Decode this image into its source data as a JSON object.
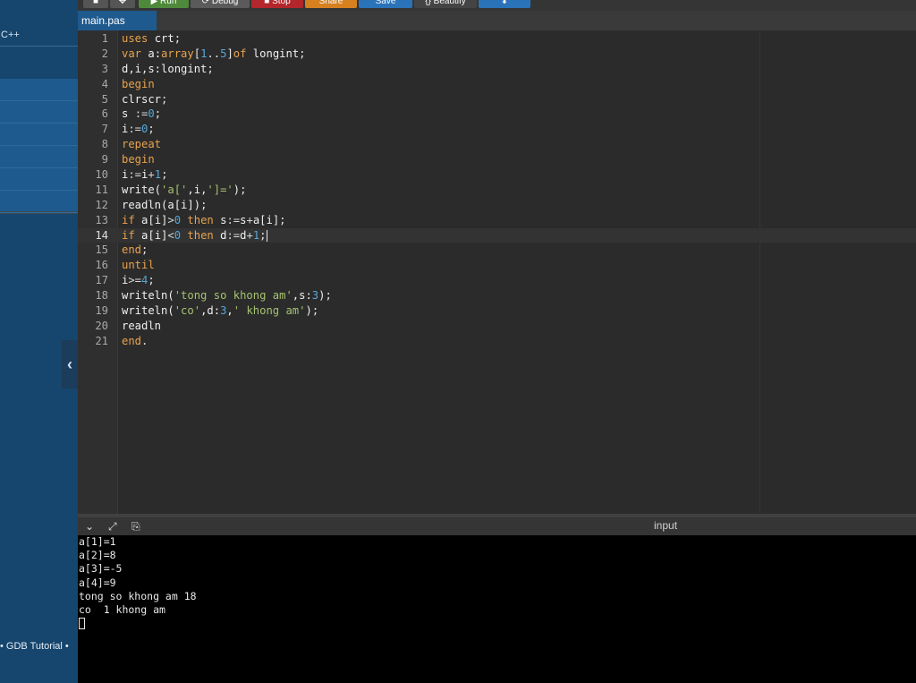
{
  "sidebar": {
    "language_label": "C++",
    "collapse_icon": "chevron-left-icon",
    "footer_link": "• GDB Tutorial •"
  },
  "toolbar": {
    "buttons": [
      {
        "label": "■",
        "color": "#555555"
      },
      {
        "label": "✥",
        "color": "#555555"
      },
      {
        "label": "▶ Run",
        "color": "#4f8a3c"
      },
      {
        "label": "⟳ Debug",
        "color": "#5a5a5a"
      },
      {
        "label": "■ Stop",
        "color": "#b3262c"
      },
      {
        "label": "Share",
        "color": "#d7801f"
      },
      {
        "label": "Save",
        "color": "#2a73b8"
      },
      {
        "label": "{} Beautify",
        "color": "#444444"
      },
      {
        "label": "⬇",
        "color": "#2a73b8"
      }
    ]
  },
  "tab": {
    "filename": "main.pas"
  },
  "editor": {
    "active_line": 14,
    "lines": [
      [
        [
          "kw",
          "uses"
        ],
        [
          "var",
          " crt"
        ],
        [
          "punct",
          ";"
        ]
      ],
      [
        [
          "kw",
          "var"
        ],
        [
          "var",
          " a:"
        ],
        [
          "kw",
          "array"
        ],
        [
          "punct",
          "["
        ],
        [
          "num",
          "1"
        ],
        [
          "punct",
          ".."
        ],
        [
          "num",
          "5"
        ],
        [
          "punct",
          "]"
        ],
        [
          "kw",
          "of"
        ],
        [
          "var",
          " longint"
        ],
        [
          "punct",
          ";"
        ]
      ],
      [
        [
          "var",
          "d,i,s:longint"
        ],
        [
          "punct",
          ";"
        ]
      ],
      [
        [
          "kw",
          "begin"
        ]
      ],
      [
        [
          "var",
          "clrscr"
        ],
        [
          "punct",
          ";"
        ]
      ],
      [
        [
          "var",
          "s "
        ],
        [
          "op",
          ":="
        ],
        [
          "num",
          "0"
        ],
        [
          "punct",
          ";"
        ]
      ],
      [
        [
          "var",
          "i"
        ],
        [
          "op",
          ":="
        ],
        [
          "num",
          "0"
        ],
        [
          "punct",
          ";"
        ]
      ],
      [
        [
          "kw",
          "repeat"
        ]
      ],
      [
        [
          "kw",
          "begin"
        ]
      ],
      [
        [
          "var",
          "i"
        ],
        [
          "op",
          ":="
        ],
        [
          "var",
          "i"
        ],
        [
          "op",
          "+"
        ],
        [
          "num",
          "1"
        ],
        [
          "punct",
          ";"
        ]
      ],
      [
        [
          "var",
          "write("
        ],
        [
          "str",
          "'a['"
        ],
        [
          "var",
          ",i,"
        ],
        [
          "str",
          "']='"
        ],
        [
          "var",
          ")"
        ],
        [
          "punct",
          ";"
        ]
      ],
      [
        [
          "var",
          "readln(a[i])"
        ],
        [
          "punct",
          ";"
        ]
      ],
      [
        [
          "kw",
          "if"
        ],
        [
          "var",
          " a[i]"
        ],
        [
          "op",
          ">"
        ],
        [
          "num",
          "0"
        ],
        [
          "kw",
          " then"
        ],
        [
          "var",
          " s"
        ],
        [
          "op",
          ":="
        ],
        [
          "var",
          "s"
        ],
        [
          "op",
          "+"
        ],
        [
          "var",
          "a[i]"
        ],
        [
          "punct",
          ";"
        ]
      ],
      [
        [
          "kw",
          "if"
        ],
        [
          "var",
          " a[i]"
        ],
        [
          "op",
          "<"
        ],
        [
          "num",
          "0"
        ],
        [
          "kw",
          " then"
        ],
        [
          "var",
          " d"
        ],
        [
          "op",
          ":="
        ],
        [
          "var",
          "d"
        ],
        [
          "op",
          "+"
        ],
        [
          "num",
          "1"
        ],
        [
          "punct",
          ";"
        ]
      ],
      [
        [
          "kw",
          "end"
        ],
        [
          "punct",
          ";"
        ]
      ],
      [
        [
          "kw",
          "until"
        ]
      ],
      [
        [
          "var",
          "i"
        ],
        [
          "op",
          ">="
        ],
        [
          "num",
          "4"
        ],
        [
          "punct",
          ";"
        ]
      ],
      [
        [
          "var",
          "writeln("
        ],
        [
          "str",
          "'tong so khong am'"
        ],
        [
          "var",
          ",s:"
        ],
        [
          "num",
          "3"
        ],
        [
          "var",
          ")"
        ],
        [
          "punct",
          ";"
        ]
      ],
      [
        [
          "var",
          "writeln("
        ],
        [
          "str",
          "'co'"
        ],
        [
          "var",
          ",d:"
        ],
        [
          "num",
          "3"
        ],
        [
          "var",
          ","
        ],
        [
          "str",
          "' khong am'"
        ],
        [
          "var",
          ")"
        ],
        [
          "punct",
          ";"
        ]
      ],
      [
        [
          "var",
          "readln"
        ]
      ],
      [
        [
          "kw",
          "end"
        ],
        [
          "punct",
          "."
        ]
      ]
    ]
  },
  "output": {
    "panel_label": "input",
    "icons": [
      "chevron-down-icon",
      "expand-icon",
      "copy-icon"
    ],
    "console_lines": [
      "a[1]=1",
      "a[2]=8",
      "a[3]=-5",
      "a[4]=9",
      "tong so khong am 18",
      "co  1 khong am"
    ]
  }
}
